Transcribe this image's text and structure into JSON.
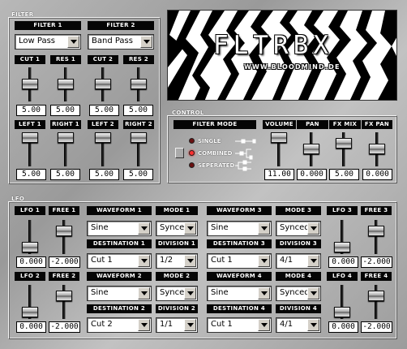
{
  "filter": {
    "title": "FILTER",
    "filter1": {
      "header": "FILTER 1",
      "type": "Low Pass",
      "cut_label": "CUT 1",
      "res_label": "RES 1",
      "cut": "5.00",
      "res": "5.00",
      "left_label": "LEFT 1",
      "right_label": "RIGHT 1",
      "left": "5.00",
      "right": "5.00"
    },
    "filter2": {
      "header": "FILTER 2",
      "type": "Band Pass",
      "cut_label": "CUT 2",
      "res_label": "RES 2",
      "cut": "5.00",
      "res": "5.00",
      "left_label": "LEFT 2",
      "right_label": "RIGHT 2",
      "left": "5.00",
      "right": "5.00"
    }
  },
  "logo": {
    "text": "FLTRBX",
    "url": "WWW.BLOODMIND.DE"
  },
  "control": {
    "title": "CONTROL",
    "mode_header": "FILTER MODE",
    "modes": [
      "SINGLE",
      "COMBINED",
      "SEPERATED"
    ],
    "active_mode": 1,
    "volume_label": "VOLUME",
    "pan_label": "PAN",
    "fxmix_label": "FX MIX",
    "fxpan_label": "FX PAN",
    "volume": "11.00",
    "pan": "0.000",
    "fxmix": "5.00",
    "fxpan": "0.000"
  },
  "lfo": {
    "title": "LFO",
    "lfo1": {
      "label": "LFO 1",
      "free_label": "FREE 1",
      "value": "0.000",
      "free": "-2.000"
    },
    "lfo2": {
      "label": "LFO 2",
      "free_label": "FREE 2",
      "value": "0.000",
      "free": "-2.000"
    },
    "lfo3": {
      "label": "LFO 3",
      "free_label": "FREE 3",
      "value": "0.000",
      "free": "-2.000"
    },
    "lfo4": {
      "label": "LFO 4",
      "free_label": "FREE 4",
      "value": "0.000",
      "free": "-2.000"
    },
    "wave1": {
      "wave_label": "WAVEFORM 1",
      "mode_label": "MODE 1",
      "wave": "Sine",
      "mode": "Synced",
      "dest_label": "DESTINATION 1",
      "div_label": "DIVISION 1",
      "dest": "Cut 1",
      "div": "1/2"
    },
    "wave2": {
      "wave_label": "WAVEFORM 2",
      "mode_label": "MODE 2",
      "wave": "Sine",
      "mode": "Synced",
      "dest_label": "DESTINATION 2",
      "div_label": "DIVISION 2",
      "dest": "Cut 2",
      "div": "1/1"
    },
    "wave3": {
      "wave_label": "WAVEFORM 3",
      "mode_label": "MODE 3",
      "wave": "Sine",
      "mode": "Synced",
      "dest_label": "DESTINATION 3",
      "div_label": "DIVISION 3",
      "dest": "Cut 1",
      "div": "4/1"
    },
    "wave4": {
      "wave_label": "WAVEFORM 4",
      "mode_label": "MODE 4",
      "wave": "Sine",
      "mode": "Synced",
      "dest_label": "DESTINATION 4",
      "div_label": "DIVISION 4",
      "dest": "Cut 1",
      "div": "4/1"
    }
  },
  "icons": {
    "dropdown": "chevron-down-icon",
    "fader": "slider-knob-icon"
  }
}
